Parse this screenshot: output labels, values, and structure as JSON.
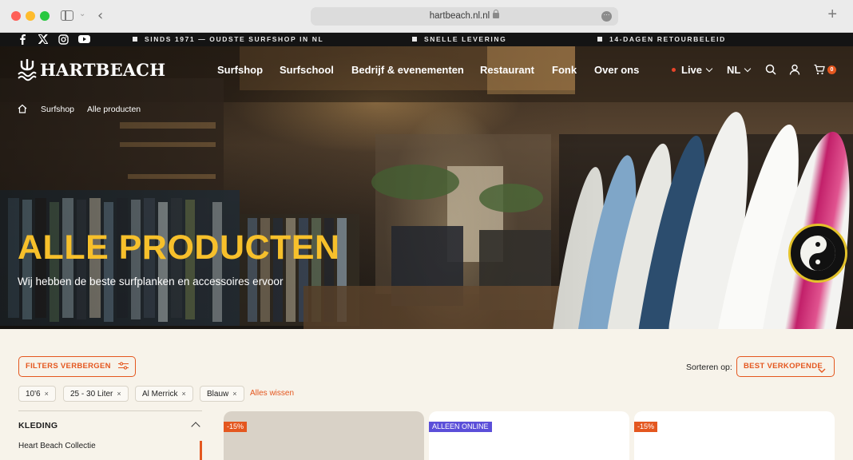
{
  "browser": {
    "url": "hartbeach.nl.nl",
    "more_glyph": "···",
    "new_tab_glyph": "+",
    "back_glyph": "‹"
  },
  "topbar": {
    "socials": [
      "f",
      "X",
      "instagram",
      "youtube"
    ],
    "usps": [
      "SINDS 1971 — OUDSTE SURFSHOP IN NL",
      "SNELLE LEVERING",
      "14-DAGEN RETOURBELEID"
    ]
  },
  "header": {
    "logo_text": "HARTBEACH",
    "logo_mark": "Ψ",
    "nav": [
      "Surfshop",
      "Surfschool",
      "Bedrijf & evenementen",
      "Restaurant",
      "Fonk",
      "Over ons"
    ],
    "live_label": "Live",
    "lang_label": "NL",
    "cart_count": "0"
  },
  "breadcrumb": {
    "items": [
      "Surfshop",
      "Alle producten"
    ]
  },
  "hero": {
    "title": "ALLE PRODUCTEN",
    "subtitle": "Wij hebben de beste surfplanken en accessoires ervoor"
  },
  "toolbar": {
    "filters_label": "FILTERS VERBERGEN",
    "sort_label": "Sorteren op:",
    "sort_value": "BEST VERKOPENDE"
  },
  "active_filters": {
    "chips": [
      "10'6",
      "25 - 30 Liter",
      "Al Merrick",
      "Blauw"
    ],
    "remove_glyph": "×",
    "clear_label": "Alles wissen"
  },
  "sidebar": {
    "heading": "KLEDING",
    "items": [
      "Heart Beach Collectie"
    ]
  },
  "products": {
    "badges": [
      "-15%",
      "ALLEEN ONLINE",
      "-15%"
    ]
  },
  "colors": {
    "accent": "#e4571f",
    "title_yellow": "#f7c02b",
    "online_badge": "#5b4fd9",
    "page_bg": "#f7f3ea"
  }
}
